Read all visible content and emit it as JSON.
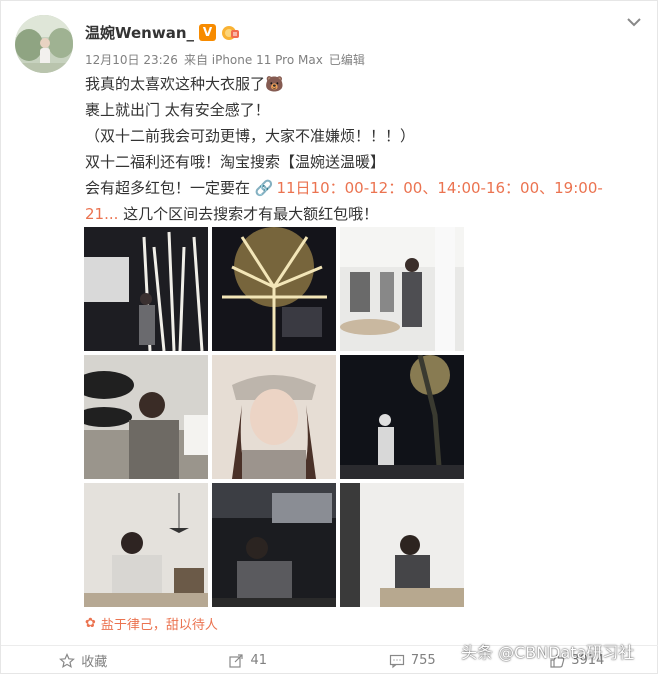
{
  "post": {
    "username": "温婉Wenwan_",
    "verified_badge": "V",
    "timestamp": "12月10日 23:26",
    "source": "来自 iPhone 11 Pro Max",
    "edited": "已编辑",
    "content": {
      "line1": "我真的太喜欢这种大衣服了🐻",
      "line2": "裹上就出门  太有安全感了！",
      "line3": "（双十二前我会可劲更博，大家不准嫌烦！！！）",
      "line4": "双十二福利还有哦！淘宝搜索【温婉送温暖】",
      "line5_prefix": "会有超多红包！一定要在 ",
      "line5_link": "11日10：00-12：00、14:00-16：00、19:00-",
      "line6_link": "21...",
      "line6_suffix": " 这几个区间去搜索才有最大额红包哦！"
    },
    "location": "盐于律己，甜以待人",
    "images": [
      {
        "icon": "photo-1"
      },
      {
        "icon": "photo-2"
      },
      {
        "icon": "photo-3"
      },
      {
        "icon": "photo-4"
      },
      {
        "icon": "photo-5"
      },
      {
        "icon": "photo-6"
      },
      {
        "icon": "photo-7"
      },
      {
        "icon": "photo-8"
      },
      {
        "icon": "photo-9"
      }
    ]
  },
  "footer": {
    "favorite_label": "收藏",
    "repost_count": "41",
    "comment_count": "755",
    "like_count": "3914"
  },
  "watermark": "头条 @CBNData研习社",
  "colors": {
    "accent": "#eb7350",
    "verified": "#f78b00",
    "meta": "#808080"
  }
}
